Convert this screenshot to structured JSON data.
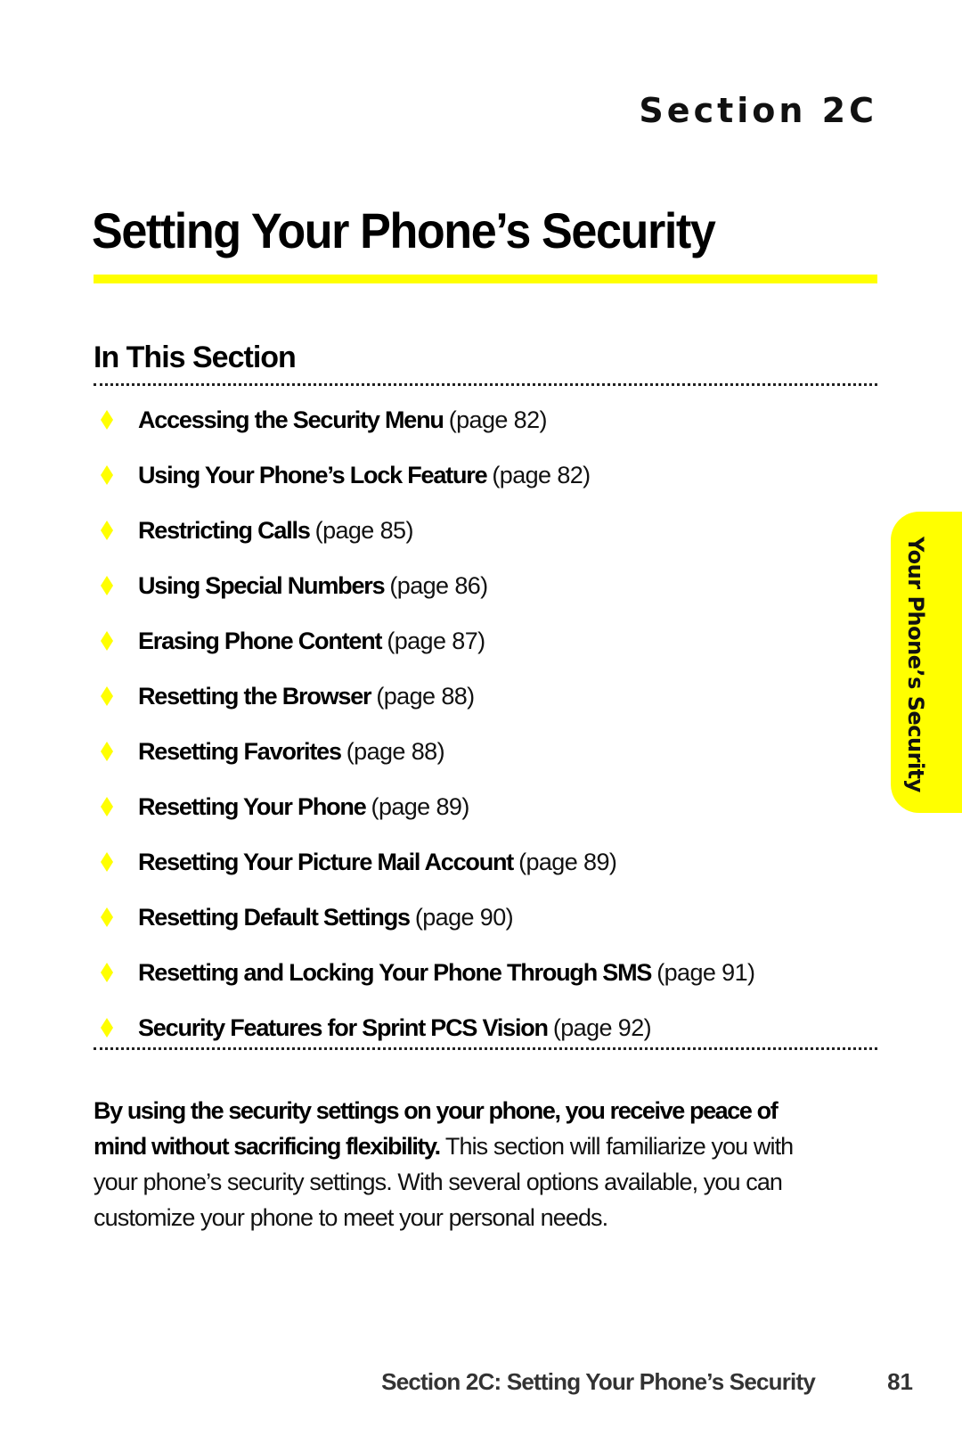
{
  "header": {
    "section_label": "Section 2C",
    "title": "Setting Your Phone’s Security",
    "accent_color": "#ffff00"
  },
  "in_this_section": {
    "heading": "In This Section",
    "bullet_icon": "diamond-icon",
    "items": [
      {
        "title": "Accessing the Security Menu",
        "page": "(page 82)"
      },
      {
        "title": "Using Your Phone’s Lock Feature",
        "page": "(page 82)"
      },
      {
        "title": "Restricting Calls",
        "page": "(page 85)"
      },
      {
        "title": "Using Special Numbers",
        "page": "(page 86)"
      },
      {
        "title": "Erasing Phone Content",
        "page": "(page 87)"
      },
      {
        "title": "Resetting the Browser",
        "page": "(page 88)"
      },
      {
        "title": "Resetting Favorites",
        "page": "(page 88)"
      },
      {
        "title": "Resetting Your Phone",
        "page": "(page 89)"
      },
      {
        "title": "Resetting Your Picture Mail Account",
        "page": "(page 89)"
      },
      {
        "title": "Resetting Default Settings",
        "page": "(page 90)"
      },
      {
        "title": "Resetting and Locking Your Phone Through SMS",
        "page": "(page 91)"
      },
      {
        "title": "Security Features for Sprint PCS Vision",
        "page": "(page 92)"
      }
    ]
  },
  "intro": {
    "bold": "By using the security settings on your phone, you receive peace of mind without sacrificing flexibility.",
    "text": " This section will familiarize you with your phone’s security settings. With several options available, you can customize your phone to meet your personal needs."
  },
  "side_tab": {
    "label": "Your Phone’s Security"
  },
  "footer": {
    "title": "Section 2C: Setting Your Phone’s Security",
    "page_number": "81"
  }
}
